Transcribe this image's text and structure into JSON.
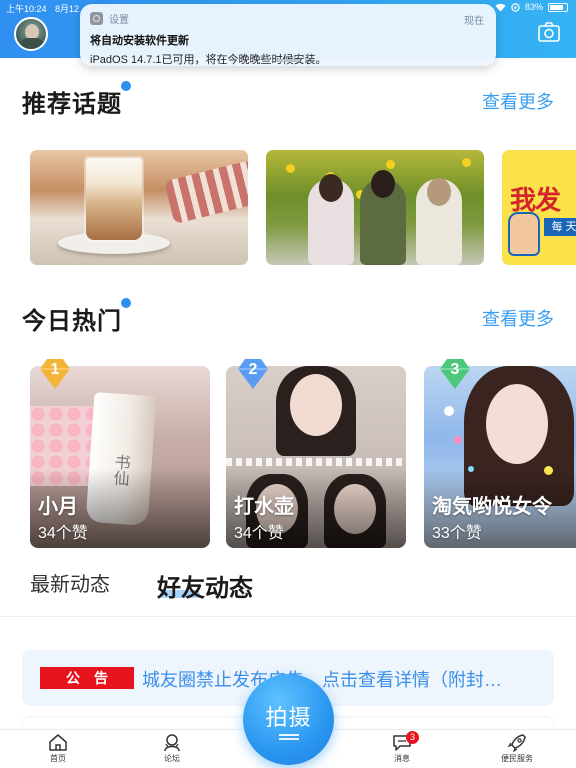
{
  "status_bar": {
    "time": "上午10:24",
    "date": "8月12",
    "battery": "83%",
    "battery_level": 0.83
  },
  "notification": {
    "app_name": "设置",
    "time": "现在",
    "title": "将自动安装软件更新",
    "body": "iPadOS 14.7.1已可用，将在今晚晚些时候安装。"
  },
  "recommended": {
    "title": "推荐话题",
    "more": "查看更多"
  },
  "topic_cards": [
    {
      "icon": "coffee-photo"
    },
    {
      "icon": "group-photo"
    },
    {
      "big_text": "我发",
      "tag": "每 天"
    }
  ],
  "hot": {
    "title": "今日热门",
    "more": "查看更多"
  },
  "hot_cards": [
    {
      "rank": "1",
      "name": "小月",
      "likes": "34个赞",
      "bottle_text": "书仙"
    },
    {
      "rank": "2",
      "name": "打水壶",
      "likes": "34个赞"
    },
    {
      "rank": "3",
      "name": "淘気哟悦女令",
      "likes": "33个赞"
    }
  ],
  "tabs": {
    "latest": "最新动态",
    "friends": "好友动态"
  },
  "notice": {
    "badge": "公告",
    "text": "城友圈禁止发布广告，点击查看详情（附封…"
  },
  "shoot_button": {
    "label": "拍摄"
  },
  "bottom_nav": [
    {
      "label": "首页",
      "icon": "home-icon"
    },
    {
      "label": "论坛",
      "icon": "forum-icon"
    },
    {
      "label": "消息",
      "icon": "message-icon",
      "badge": "3"
    },
    {
      "label": "便民服务",
      "icon": "rocket-icon"
    }
  ],
  "colors": {
    "brand_blue": "#2f8ff1",
    "link_blue": "#3a9ff1",
    "badge_red": "#e8141d",
    "rank1": "#f3b43a",
    "rank2": "#5a9cf2",
    "rank3": "#4cc77b"
  }
}
